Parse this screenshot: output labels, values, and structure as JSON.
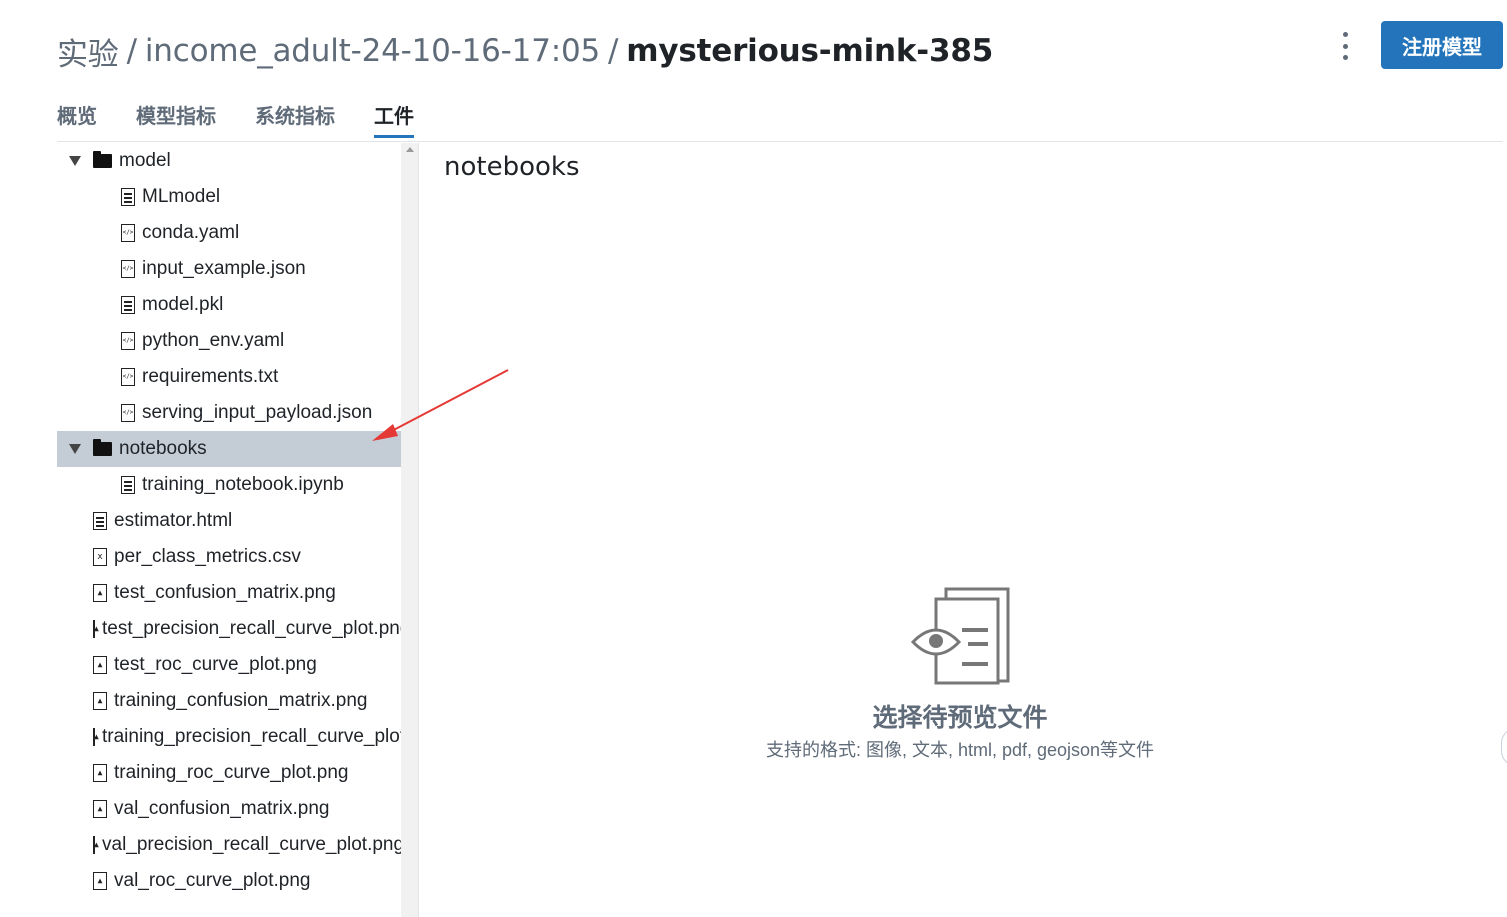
{
  "breadcrumb": {
    "root": "实验",
    "separator": "/",
    "experiment": "income_adult-24-10-16-17:05",
    "run": "mysterious-mink-385"
  },
  "register_button": "注册模型",
  "tabs": [
    {
      "label": "概览",
      "active": false
    },
    {
      "label": "模型指标",
      "active": false
    },
    {
      "label": "系统指标",
      "active": false
    },
    {
      "label": "工件",
      "active": true
    }
  ],
  "tree": [
    {
      "label": "model",
      "kind": "folder",
      "expanded": true,
      "depth": 0
    },
    {
      "label": "MLmodel",
      "kind": "text-file",
      "depth": 1
    },
    {
      "label": "conda.yaml",
      "kind": "code-file",
      "depth": 1
    },
    {
      "label": "input_example.json",
      "kind": "code-file",
      "depth": 1
    },
    {
      "label": "model.pkl",
      "kind": "text-file",
      "depth": 1
    },
    {
      "label": "python_env.yaml",
      "kind": "code-file",
      "depth": 1
    },
    {
      "label": "requirements.txt",
      "kind": "code-file",
      "depth": 1
    },
    {
      "label": "serving_input_payload.json",
      "kind": "code-file",
      "depth": 1
    },
    {
      "label": "notebooks",
      "kind": "folder",
      "expanded": true,
      "selected": true,
      "depth": 0
    },
    {
      "label": "training_notebook.ipynb",
      "kind": "text-file",
      "depth": 1
    },
    {
      "label": "estimator.html",
      "kind": "text-file",
      "depth": 0
    },
    {
      "label": "per_class_metrics.csv",
      "kind": "table-file",
      "depth": 0
    },
    {
      "label": "test_confusion_matrix.png",
      "kind": "image-file",
      "depth": 0
    },
    {
      "label": "test_precision_recall_curve_plot.png",
      "kind": "image-file",
      "depth": 0
    },
    {
      "label": "test_roc_curve_plot.png",
      "kind": "image-file",
      "depth": 0
    },
    {
      "label": "training_confusion_matrix.png",
      "kind": "image-file",
      "depth": 0
    },
    {
      "label": "training_precision_recall_curve_plot.png",
      "kind": "image-file",
      "depth": 0
    },
    {
      "label": "training_roc_curve_plot.png",
      "kind": "image-file",
      "depth": 0
    },
    {
      "label": "val_confusion_matrix.png",
      "kind": "image-file",
      "depth": 0
    },
    {
      "label": "val_precision_recall_curve_plot.png",
      "kind": "image-file",
      "depth": 0
    },
    {
      "label": "val_roc_curve_plot.png",
      "kind": "image-file",
      "depth": 0
    }
  ],
  "preview": {
    "title": "notebooks",
    "empty_icon": "file-preview-eye-icon",
    "empty_title": "选择待预览文件",
    "empty_desc": "支持的格式: 图像, 文本, html, pdf, geojson等文件"
  },
  "annotation": {
    "icon": "red-arrow-icon",
    "color": "#e53935"
  },
  "colors": {
    "accent": "#2374bb",
    "selected_row": "#c4cdd6",
    "muted_text": "#5f6b78"
  }
}
